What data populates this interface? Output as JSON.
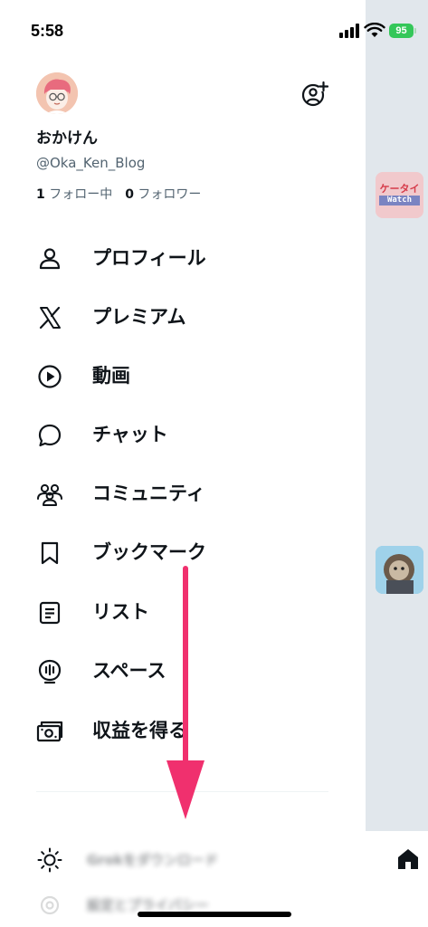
{
  "status_bar": {
    "time": "5:58",
    "battery": "95",
    "battery_color": "#34c759"
  },
  "profile": {
    "display_name": "おかけん",
    "handle": "@Oka_Ken_Blog",
    "following_count": "1",
    "following_label": "フォロー中",
    "followers_count": "0",
    "followers_label": "フォロワー",
    "avatar_icon": "avatar-illustration",
    "add_account_icon": "add-account-icon"
  },
  "menu": {
    "items": [
      {
        "label": "プロフィール",
        "icon": "person-icon"
      },
      {
        "label": "プレミアム",
        "icon": "x-logo-icon"
      },
      {
        "label": "動画",
        "icon": "play-circle-icon"
      },
      {
        "label": "チャット",
        "icon": "chat-bubble-icon"
      },
      {
        "label": "コミュニティ",
        "icon": "people-icon"
      },
      {
        "label": "ブックマーク",
        "icon": "bookmark-icon"
      },
      {
        "label": "リスト",
        "icon": "list-icon"
      },
      {
        "label": "スペース",
        "icon": "spaces-icon"
      },
      {
        "label": "収益を得る",
        "icon": "money-icon"
      }
    ]
  },
  "settings": {
    "items": [
      {
        "label": "Grokをダウンロード",
        "icon": "sun-icon"
      },
      {
        "label": "設定とプライバシー",
        "icon": "gear-icon"
      }
    ]
  },
  "background": {
    "thumb1_top": "ケータイ",
    "thumb1_bottom": "Watch",
    "home_icon": "home-icon"
  },
  "overlay": {
    "arrow_color": "#f0306e"
  }
}
